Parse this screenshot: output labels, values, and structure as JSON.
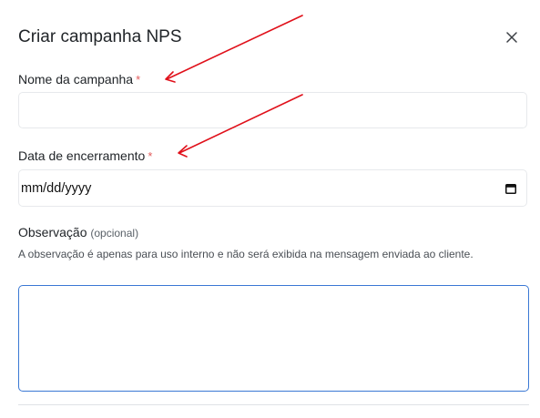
{
  "modal": {
    "title": "Criar campanha NPS",
    "close_label": "×"
  },
  "fields": {
    "name": {
      "label": "Nome da campanha",
      "required_mark": "*",
      "value": ""
    },
    "date": {
      "label": "Data de encerramento",
      "required_mark": "*",
      "value": "mm/dd/yyyy"
    },
    "note": {
      "label": "Observação",
      "optional": "(opcional)",
      "help": "A observação é apenas para uso interno e não será exibida na mensagem enviada ao cliente.",
      "value": ""
    }
  },
  "colors": {
    "required": "#e25c5c",
    "focus_border": "#3a78d4",
    "annotation_arrow": "#e0101a"
  },
  "icons": {
    "close": "close-icon",
    "calendar": "calendar-icon"
  }
}
